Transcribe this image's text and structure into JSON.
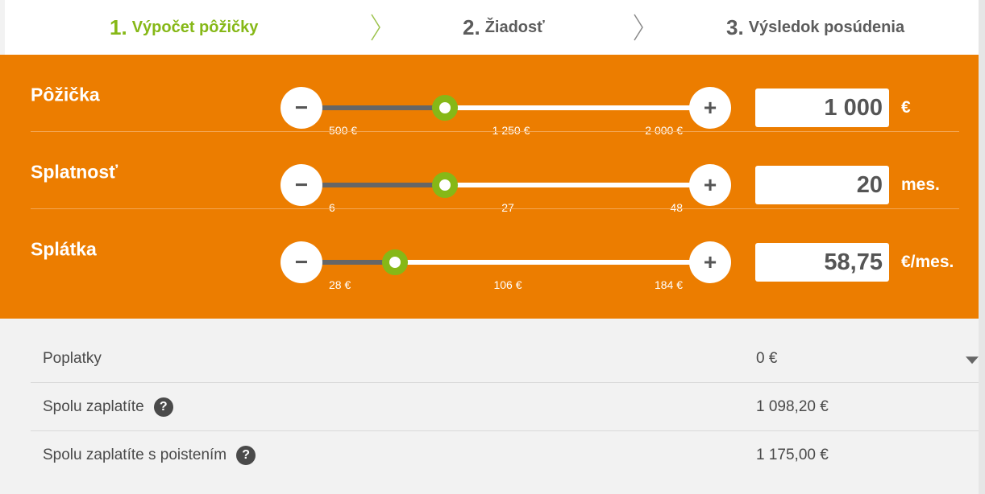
{
  "steps": [
    {
      "num": "1.",
      "label": "Výpočet pôžičky",
      "active": true
    },
    {
      "num": "2.",
      "label": "Žiadosť",
      "active": false
    },
    {
      "num": "3.",
      "label": "Výsledok posúdenia",
      "active": false
    }
  ],
  "sliders": [
    {
      "label": "Pôžička",
      "min": 500,
      "max": 2000,
      "value": 1000,
      "min_label": "500 €",
      "mid_label": "1 250 €",
      "max_label": "2 000 €",
      "display_value": "1 000",
      "unit": "€"
    },
    {
      "label": "Splatnosť",
      "min": 6,
      "max": 48,
      "value": 20,
      "min_label": "6",
      "mid_label": "27",
      "max_label": "48",
      "display_value": "20",
      "unit": "mes."
    },
    {
      "label": "Splátka",
      "min": 28,
      "max": 184,
      "value": 58.75,
      "min_label": "28 €",
      "mid_label": "106 €",
      "max_label": "184 €",
      "display_value": "58,75",
      "unit": "€/mes."
    }
  ],
  "buttons": {
    "minus": "−",
    "plus": "+"
  },
  "results": [
    {
      "label": "Poplatky",
      "value": "0 €"
    },
    {
      "label": "Spolu zaplatíte",
      "value": "1 098,20 €"
    },
    {
      "label": "Spolu zaplatíte s poistením",
      "value": "1 175,00 €"
    }
  ],
  "help_icon_glyph": "?",
  "colors": {
    "accent": "#ec7d00",
    "active_step": "#86b817",
    "thumb": "#86b817"
  }
}
